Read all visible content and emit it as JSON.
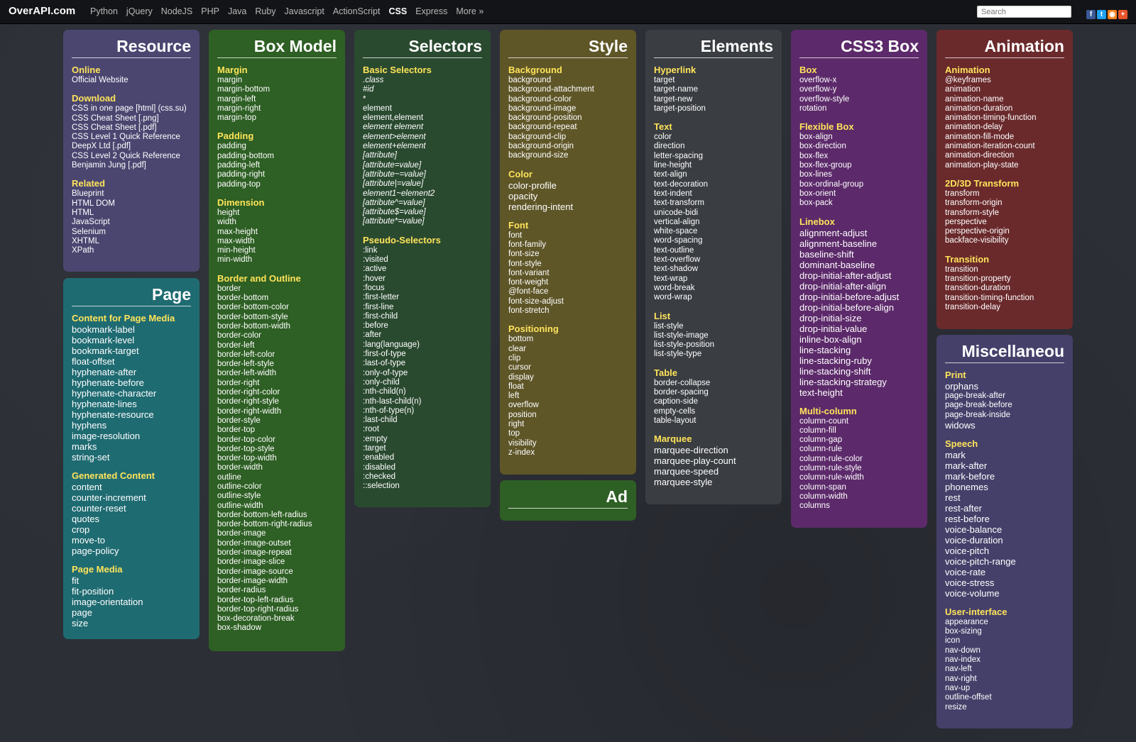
{
  "topbar": {
    "logo": "OverAPI.com",
    "nav": [
      "Python",
      "jQuery",
      "NodeJS",
      "PHP",
      "Java",
      "Ruby",
      "Javascript",
      "ActionScript",
      "CSS",
      "Express",
      "More »"
    ],
    "active": "CSS",
    "search_placeholder": "Search",
    "social": [
      {
        "icon": "facebook-icon",
        "glyph": "f",
        "color": "#3b5998"
      },
      {
        "icon": "twitter-icon",
        "glyph": "t",
        "color": "#1da1f2"
      },
      {
        "icon": "rss-icon",
        "glyph": "◉",
        "color": "#f58220"
      },
      {
        "icon": "plus-icon",
        "glyph": "+",
        "color": "#e8542a"
      }
    ]
  },
  "cards": [
    {
      "id": "resource",
      "title": "Resource",
      "color": "#4b4670",
      "sections": [
        {
          "head": "Online",
          "items": [
            "Official Website"
          ]
        },
        {
          "head": "Download",
          "items": [
            "CSS in one page [html] (css.su)",
            "CSS Cheat Sheet [.png]",
            "CSS Cheat Sheet [.pdf]",
            "CSS Level 1 Quick Reference",
            "DeepX Ltd [.pdf]",
            "CSS Level 2 Quick Reference",
            "Benjamin Jung [.pdf]"
          ]
        },
        {
          "head": "Related",
          "items": [
            "Blueprint",
            "HTML DOM",
            "HTML",
            "JavaScript",
            "Selenium",
            "XHTML",
            "XPath"
          ]
        }
      ]
    },
    {
      "id": "page",
      "title": "Page",
      "color": "#1f6b72",
      "big": true,
      "sections": [
        {
          "head": "Content for Page Media",
          "items": [
            "bookmark-label",
            "bookmark-level",
            "bookmark-target",
            "float-offset",
            "hyphenate-after",
            "hyphenate-before",
            "hyphenate-character",
            "hyphenate-lines",
            "hyphenate-resource",
            "hyphens",
            "image-resolution",
            "marks",
            "string-set"
          ]
        },
        {
          "head": "Generated Content",
          "items": [
            "content",
            "counter-increment",
            "counter-reset",
            "quotes",
            "crop",
            "move-to",
            "page-policy"
          ],
          "large_from": 4
        },
        {
          "head": "Page Media",
          "items": [
            "fit",
            "fit-position",
            "image-orientation",
            "page",
            "size"
          ]
        }
      ]
    },
    {
      "id": "boxmodel",
      "title": "Box Model",
      "color": "#2e5f24",
      "sections": [
        {
          "head": "Margin",
          "items": [
            "margin",
            "margin-bottom",
            "margin-left",
            "margin-right",
            "margin-top"
          ]
        },
        {
          "head": "Padding",
          "items": [
            "padding",
            "padding-bottom",
            "padding-left",
            "padding-right",
            "padding-top"
          ]
        },
        {
          "head": "Dimension",
          "items": [
            "height",
            "width",
            "max-height",
            "max-width",
            "min-height",
            "min-width"
          ]
        },
        {
          "head": "Border and Outline",
          "items": [
            "border",
            "border-bottom",
            "border-bottom-color",
            "border-bottom-style",
            "border-bottom-width",
            "border-color",
            "border-left",
            "border-left-color",
            "border-left-style",
            "border-left-width",
            "border-right",
            "border-right-color",
            "border-right-style",
            "border-right-width",
            "border-style",
            "border-top",
            "border-top-color",
            "border-top-style",
            "border-top-width",
            "border-width",
            "outline",
            "outline-color",
            "outline-style",
            "outline-width",
            "border-bottom-left-radius",
            "border-bottom-right-radius",
            "border-image",
            "border-image-outset",
            "border-image-repeat",
            "border-image-slice",
            "border-image-source",
            "border-image-width",
            "border-radius",
            "border-top-left-radius",
            "border-top-right-radius",
            "box-decoration-break",
            "box-shadow"
          ]
        }
      ]
    },
    {
      "id": "selectors",
      "title": "Selectors",
      "color": "#2a4a30",
      "sections": [
        {
          "head": "Basic Selectors",
          "items": [
            ".class",
            "#id",
            "*",
            "element",
            "element,element",
            "element element",
            "element>element",
            "element+element",
            "[attribute]",
            "[attribute=value]",
            "[attribute~=value]",
            "[attribute|=value]",
            "element1~element2",
            "[attribute^=value]",
            "[attribute$=value]",
            "[attribute*=value]"
          ],
          "italic": [
            0,
            1,
            5,
            6,
            7,
            8,
            9,
            10,
            11,
            12,
            13,
            14,
            15
          ]
        },
        {
          "head": "Pseudo-Selectors",
          "items": [
            ":link",
            ":visited",
            ":active",
            ":hover",
            ":focus",
            ":first-letter",
            ":first-line",
            ":first-child",
            ":before",
            ":after",
            ":lang(language)",
            ":first-of-type",
            ":last-of-type",
            ":only-of-type",
            ":only-child",
            ":nth-child(n)",
            ":nth-last-child(n)",
            ":nth-of-type(n)",
            ":last-child",
            ":root",
            ":empty",
            ":target",
            ":enabled",
            ":disabled",
            ":checked",
            "::selection"
          ]
        }
      ]
    },
    {
      "id": "style",
      "title": "Style",
      "color": "#5f5628",
      "sections": [
        {
          "head": "Background",
          "items": [
            "background",
            "background-attachment",
            "background-color",
            "background-image",
            "background-position",
            "background-repeat",
            "background-clip",
            "background-origin",
            "background-size"
          ]
        },
        {
          "head": "Color",
          "items": [
            "color-profile",
            "opacity",
            "rendering-intent"
          ],
          "large_all": true
        },
        {
          "head": "Font",
          "items": [
            "font",
            "font-family",
            "font-size",
            "font-style",
            "font-variant",
            "font-weight",
            "@font-face",
            "font-size-adjust",
            "font-stretch"
          ]
        },
        {
          "head": "Positioning",
          "items": [
            "bottom",
            "clear",
            "clip",
            "cursor",
            "display",
            "float",
            "left",
            "overflow",
            "position",
            "right",
            "top",
            "visibility",
            "z-index"
          ]
        }
      ]
    },
    {
      "id": "ad",
      "title": "Ad",
      "color": "#2e5f24",
      "sections": []
    },
    {
      "id": "elements",
      "title": "Elements",
      "color": "#3a3d42",
      "sections": [
        {
          "head": "Hyperlink",
          "items": [
            "target",
            "target-name",
            "target-new",
            "target-position"
          ]
        },
        {
          "head": "Text",
          "items": [
            "color",
            "direction",
            "letter-spacing",
            "line-height",
            "text-align",
            "text-decoration",
            "text-indent",
            "text-transform",
            "unicode-bidi",
            "vertical-align",
            "white-space",
            "word-spacing",
            "text-outline",
            "text-overflow",
            "text-shadow",
            "text-wrap",
            "word-break",
            "word-wrap"
          ]
        },
        {
          "head": "List",
          "items": [
            "list-style",
            "list-style-image",
            "list-style-position",
            "list-style-type"
          ]
        },
        {
          "head": "Table",
          "items": [
            "border-collapse",
            "border-spacing",
            "caption-side",
            "empty-cells",
            "table-layout"
          ]
        },
        {
          "head": "Marquee",
          "items": [
            "marquee-direction",
            "marquee-play-count",
            "marquee-speed",
            "marquee-style"
          ],
          "large_all": true
        }
      ]
    },
    {
      "id": "css3box",
      "title": "CSS3 Box",
      "color": "#5c2a6a",
      "sections": [
        {
          "head": "Box",
          "items": [
            "overflow-x",
            "overflow-y",
            "overflow-style",
            "rotation"
          ]
        },
        {
          "head": "Flexible Box",
          "items": [
            "box-align",
            "box-direction",
            "box-flex",
            "box-flex-group",
            "box-lines",
            "box-ordinal-group",
            "box-orient",
            "box-pack"
          ]
        },
        {
          "head": "Linebox",
          "items": [
            "alignment-adjust",
            "alignment-baseline",
            "baseline-shift",
            "dominant-baseline",
            "drop-initial-after-adjust",
            "drop-initial-after-align",
            "drop-initial-before-adjust",
            "drop-initial-before-align",
            "drop-initial-size",
            "drop-initial-value",
            "inline-box-align",
            "line-stacking",
            "line-stacking-ruby",
            "line-stacking-shift",
            "line-stacking-strategy",
            "text-height"
          ],
          "large_all": true
        },
        {
          "head": "Multi-column",
          "items": [
            "column-count",
            "column-fill",
            "column-gap",
            "column-rule",
            "column-rule-color",
            "column-rule-style",
            "column-rule-width",
            "column-span",
            "column-width",
            "columns"
          ]
        }
      ]
    },
    {
      "id": "animation",
      "title": "Animation",
      "color": "#6a2a2c",
      "sections": [
        {
          "head": "Animation",
          "items": [
            "@keyframes",
            "animation",
            "animation-name",
            "animation-duration",
            "animation-timing-function",
            "animation-delay",
            "animation-fill-mode",
            "animation-iteration-count",
            "animation-direction",
            "animation-play-state"
          ]
        },
        {
          "head": "2D/3D Transform",
          "items": [
            "transform",
            "transform-origin",
            "transform-style",
            "perspective",
            "perspective-origin",
            "backface-visibility"
          ]
        },
        {
          "head": "Transition",
          "items": [
            "transition",
            "transition-property",
            "transition-duration",
            "transition-timing-function",
            "transition-delay"
          ]
        }
      ]
    },
    {
      "id": "misc",
      "title": "Miscellaneou",
      "color": "#45406a",
      "sections": [
        {
          "head": "Print",
          "items": [
            "orphans",
            "page-break-after",
            "page-break-before",
            "page-break-inside",
            "widows"
          ],
          "large_idx": [
            0,
            4
          ]
        },
        {
          "head": "Speech",
          "items": [
            "mark",
            "mark-after",
            "mark-before",
            "phonemes",
            "rest",
            "rest-after",
            "rest-before",
            "voice-balance",
            "voice-duration",
            "voice-pitch",
            "voice-pitch-range",
            "voice-rate",
            "voice-stress",
            "voice-volume"
          ],
          "large_all": true
        },
        {
          "head": "User-interface",
          "items": [
            "appearance",
            "box-sizing",
            "icon",
            "nav-down",
            "nav-index",
            "nav-left",
            "nav-right",
            "nav-up",
            "outline-offset",
            "resize"
          ]
        }
      ]
    }
  ]
}
